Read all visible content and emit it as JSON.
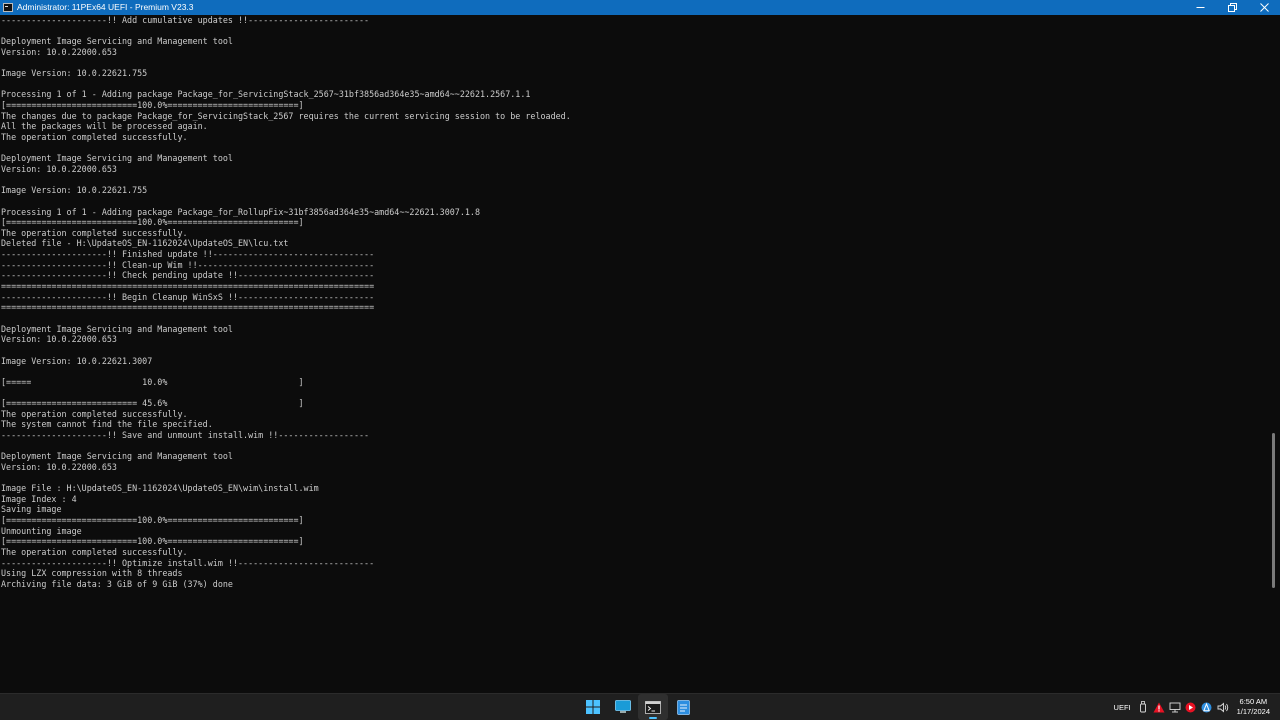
{
  "window": {
    "title": "Administrator:  11PEx64 UEFI - Premium V23.3",
    "minimize_label": "minimize",
    "maximize_label": "restore",
    "close_label": "close"
  },
  "console": {
    "lines": [
      "---------------------!! Add cumulative updates !!------------------------",
      "",
      "Deployment Image Servicing and Management tool",
      "Version: 10.0.22000.653",
      "",
      "Image Version: 10.0.22621.755",
      "",
      "Processing 1 of 1 - Adding package Package_for_ServicingStack_2567~31bf3856ad364e35~amd64~~22621.2567.1.1",
      "[==========================100.0%==========================]",
      "The changes due to package Package_for_ServicingStack_2567 requires the current servicing session to be reloaded.",
      "All the packages will be processed again.",
      "The operation completed successfully.",
      "",
      "Deployment Image Servicing and Management tool",
      "Version: 10.0.22000.653",
      "",
      "Image Version: 10.0.22621.755",
      "",
      "Processing 1 of 1 - Adding package Package_for_RollupFix~31bf3856ad364e35~amd64~~22621.3007.1.8",
      "[==========================100.0%==========================]",
      "The operation completed successfully.",
      "Deleted file - H:\\UpdateOS_EN-1162024\\UpdateOS_EN\\lcu.txt",
      "---------------------!! Finished update !!--------------------------------",
      "---------------------!! Clean-up Wim !!-----------------------------------",
      "---------------------!! Check pending update !!---------------------------",
      "==========================================================================",
      "---------------------!! Begin Cleanup WinSxS !!---------------------------",
      "==========================================================================",
      "",
      "Deployment Image Servicing and Management tool",
      "Version: 10.0.22000.653",
      "",
      "Image Version: 10.0.22621.3007",
      "",
      "[=====                      10.0%                          ]",
      "",
      "[========================== 45.6%                          ]",
      "The operation completed successfully.",
      "The system cannot find the file specified.",
      "---------------------!! Save and unmount install.wim !!------------------",
      "",
      "Deployment Image Servicing and Management tool",
      "Version: 10.0.22000.653",
      "",
      "Image File : H:\\UpdateOS_EN-1162024\\UpdateOS_EN\\wim\\install.wim",
      "Image Index : 4",
      "Saving image",
      "[==========================100.0%==========================]",
      "Unmounting image",
      "[==========================100.0%==========================]",
      "The operation completed successfully.",
      "---------------------!! Optimize install.wim !!---------------------------",
      "Using LZX compression with 8 threads",
      "Archiving file data: 3 GiB of 9 GiB (37%) done"
    ]
  },
  "taskbar": {
    "apps": [
      {
        "icon": "windows-start-icon",
        "active": false
      },
      {
        "icon": "desktop-explorer-icon",
        "active": false
      },
      {
        "icon": "terminal-icon",
        "active": true
      },
      {
        "icon": "notepad-icon",
        "active": false
      }
    ],
    "tray": {
      "uefi_label": "UEFI",
      "time": "6:50 AM",
      "date": "1/17/2024",
      "icons": [
        "usb-eject-icon",
        "network-warning-icon",
        "network-icon",
        "media-record-icon",
        "accessibility-icon",
        "volume-icon"
      ]
    }
  },
  "colors": {
    "titlebar": "#0f6cbd",
    "console_bg": "#0c0c0c",
    "console_text": "#cccccc",
    "taskbar_bg": "#1f1f1f"
  }
}
